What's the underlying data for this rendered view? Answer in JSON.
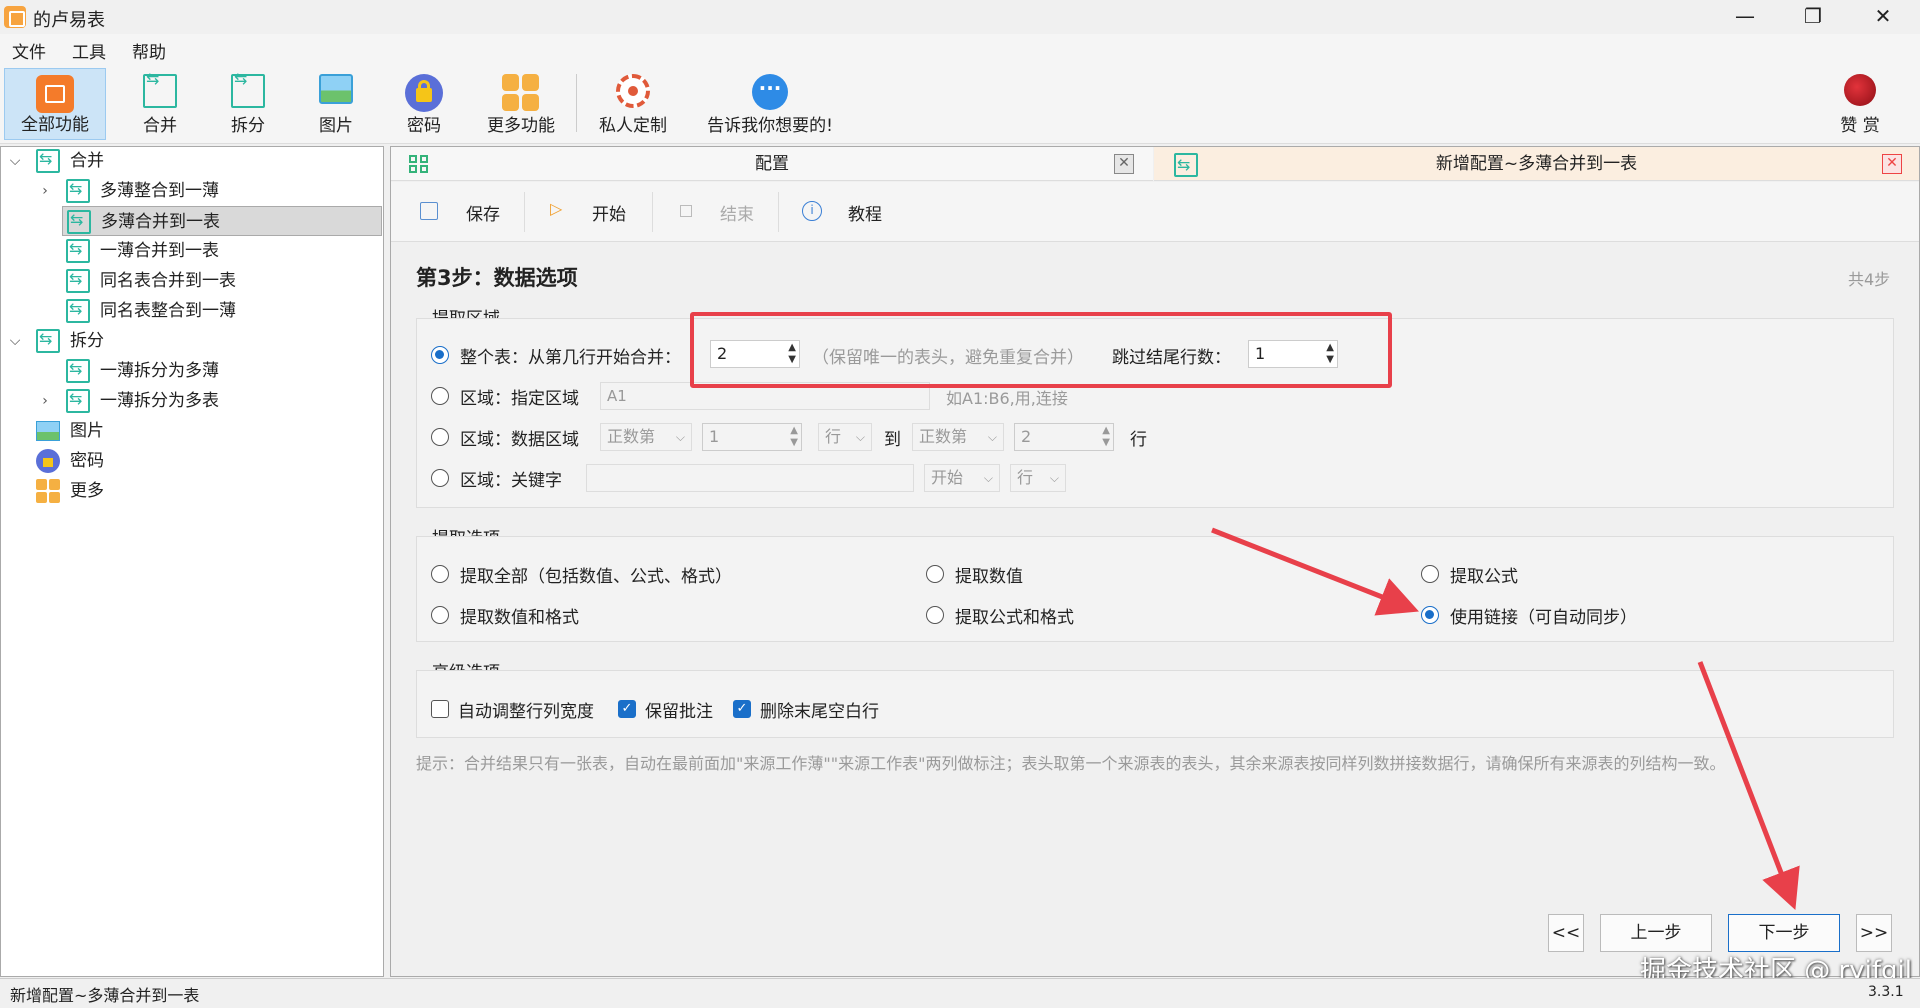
{
  "window": {
    "title": "的卢易表"
  },
  "menu": [
    "文件",
    "工具",
    "帮助"
  ],
  "toolbar": {
    "all": "全部功能",
    "merge": "合并",
    "split": "拆分",
    "image": "图片",
    "password": "密码",
    "more": "更多功能",
    "custom": "私人定制",
    "feedback": "告诉我你想要的!",
    "donate": "赞 赏"
  },
  "tree": {
    "merge": "合并",
    "merge_items": [
      "多薄整合到一薄",
      "多薄合并到一表",
      "一薄合并到一表",
      "同名表合并到一表",
      "同名表整合到一薄"
    ],
    "split": "拆分",
    "split_items": [
      "一薄拆分为多薄",
      "一薄拆分为多表"
    ],
    "image": "图片",
    "password": "密码",
    "more": "更多"
  },
  "tabs": {
    "config": "配置",
    "new_config": "新增配置~多薄合并到一表"
  },
  "actions": {
    "save": "保存",
    "start": "开始",
    "stop": "结束",
    "tutorial": "教程"
  },
  "step": {
    "title": "第3步：数据选项",
    "total": "共4步"
  },
  "extract_area": {
    "title": "提取区域",
    "whole_label": "整个表：从第几行开始合并：",
    "whole_value": "2",
    "whole_hint": "（保留唯一的表头，避免重复合并）",
    "skip_label": "跳过结尾行数：",
    "skip_value": "1",
    "range_label": "区域：指定区域",
    "range_value": "A1",
    "range_hint": "如A1:B6,用,连接",
    "data_label": "区域：数据区域",
    "data_from_mode": "正数第",
    "data_from_value": "1",
    "data_from_unit": "行",
    "to": "到",
    "data_to_mode": "正数第",
    "data_to_value": "2",
    "data_to_unit": "行",
    "keyword_label": "区域：关键字",
    "keyword_pos": "开始",
    "keyword_unit": "行"
  },
  "extract_options": {
    "title": "提取选项",
    "all": "提取全部（包括数值、公式、格式）",
    "values": "提取数值",
    "formula": "提取公式",
    "values_fmt": "提取数值和格式",
    "formula_fmt": "提取公式和格式",
    "link": "使用链接（可自动同步）"
  },
  "advanced": {
    "title": "高级选项",
    "autofit": "自动调整行列宽度",
    "keep_comments": "保留批注",
    "del_blank": "删除末尾空白行"
  },
  "hint": "提示：合并结果只有一张表，自动在最前面加\"来源工作薄\"\"来源工作表\"两列做标注；表头取第一个来源表的表头，其余来源表按同样列数拼接数据行，请确保所有来源表的列结构一致。",
  "nav": {
    "first": "<<",
    "prev": "上一步",
    "next": "下一步",
    "last": ">>"
  },
  "watermark": "掘金技术社区 @ ryjfgjl",
  "status": {
    "left": "新增配置~多薄合并到一表",
    "version": "3.3.1"
  },
  "colors": {
    "accent": "#1a6fc9",
    "annotation": "#e8404a",
    "tab_active": "#fbeee0"
  }
}
